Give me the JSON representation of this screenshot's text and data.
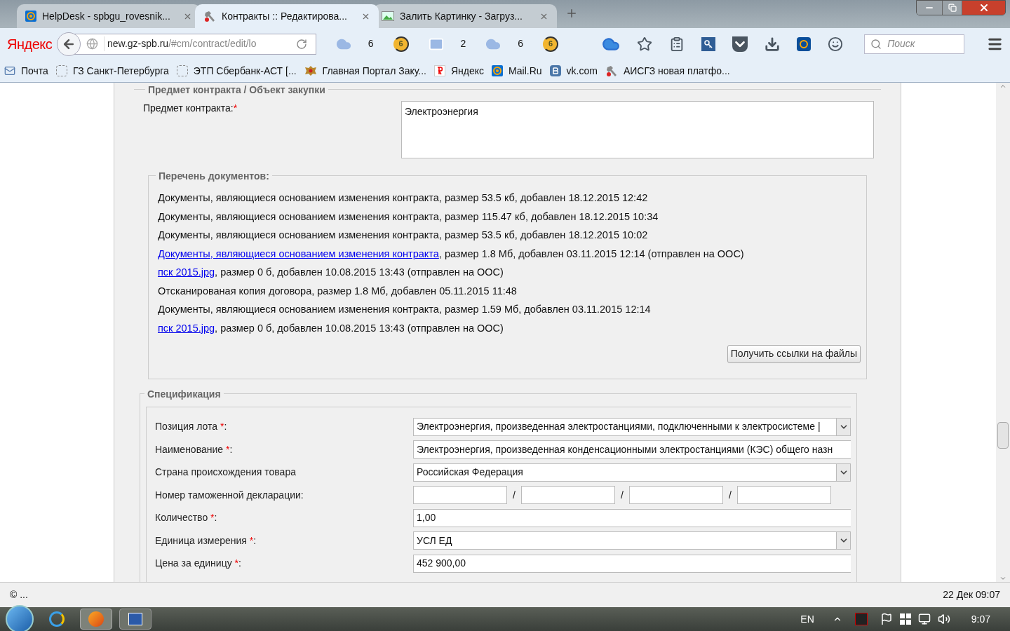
{
  "browser": {
    "tabs": [
      {
        "title": "HelpDesk - spbgu_rovesnik...",
        "kind": "mailru",
        "selected": false
      },
      {
        "title": "Контракты :: Редактирова...",
        "kind": "hammer",
        "selected": true
      },
      {
        "title": "Залить Картинку - Загруз...",
        "kind": "image",
        "selected": false
      }
    ],
    "logo": "Яндекс",
    "url_host": "new.gz-spb.ru",
    "url_path": "/#cm/contract/edit/lo",
    "widgets": [
      {
        "kind": "cloud",
        "value": "6"
      },
      {
        "kind": "coin",
        "value": "6"
      },
      {
        "kind": "mail",
        "value": "2"
      },
      {
        "kind": "cloud",
        "value": "6"
      },
      {
        "kind": "coin",
        "value": "6"
      }
    ],
    "search": {
      "placeholder": "Поиск"
    },
    "bookmarks": [
      {
        "label": "Почта",
        "kind": "mail"
      },
      {
        "label": "ГЗ Санкт-Петербурга",
        "kind": "blank"
      },
      {
        "label": "ЭТП Сбербанк-АСТ [...",
        "kind": "blank"
      },
      {
        "label": "Главная Портал Заку...",
        "kind": "emblem"
      },
      {
        "label": "Яндекс",
        "kind": "yandex"
      },
      {
        "label": "Mail.Ru",
        "kind": "mailru"
      },
      {
        "label": "vk.com",
        "kind": "vk"
      },
      {
        "label": "АИСГЗ новая платфо...",
        "kind": "hammer"
      }
    ]
  },
  "subject": {
    "legend": "Предмет контракта / Объект закупки",
    "label": "Предмет контракта:",
    "mark": "*",
    "value": "Электроэнергия"
  },
  "documents": {
    "legend": "Перечень документов:",
    "items": [
      {
        "text": "Документы, являющиеся основанием изменения контракта, размер 53.5 кб, добавлен 18.12.2015 12:42"
      },
      {
        "text": "Документы, являющиеся основанием изменения контракта, размер 115.47 кб, добавлен 18.12.2015 10:34"
      },
      {
        "text": "Документы, являющиеся основанием изменения контракта, размер 53.5 кб, добавлен 18.12.2015 10:02"
      },
      {
        "link": "Документы, являющиеся основанием изменения контракта",
        "text": ", размер 1.8 Мб, добавлен 03.11.2015 12:14 (отправлен на ООС)"
      },
      {
        "link": "пск 2015.jpg",
        "text": ", размер 0 б, добавлен 10.08.2015 13:43 (отправлен на ООС)"
      },
      {
        "text": "Отсканированая копия договора, размер 1.8 Мб, добавлен 05.11.2015 11:48"
      },
      {
        "text": "Документы, являющиеся основанием изменения контракта, размер 1.59 Мб, добавлен 03.11.2015 12:14"
      },
      {
        "link": "пск 2015.jpg",
        "text": ", размер 0 б, добавлен 10.08.2015 13:43 (отправлен на ООС)"
      }
    ],
    "button": "Получить ссылки на файлы"
  },
  "specification": {
    "legend": "Спецификация",
    "rows": [
      {
        "kind": "select",
        "label": "Позиция лота",
        "mark": "*",
        "colon": ":",
        "value": "Электроэнергия, произведенная электростанциями, подключенными к электросистеме |"
      },
      {
        "kind": "text",
        "label": "Наименование",
        "mark": "*",
        "colon": ":",
        "value": "Электроэнергия, произведенная конденсационными электростанциями (КЭС) общего назн"
      },
      {
        "kind": "select",
        "label": "Страна происхождения товара",
        "value": "Российская Федерация"
      },
      {
        "kind": "customs",
        "label": "Номер таможенной декларации:",
        "separators": [
          "/",
          "/",
          "/"
        ]
      },
      {
        "kind": "text",
        "label": "Количество",
        "mark": "*",
        "colon": ":",
        "value": "1,00"
      },
      {
        "kind": "select",
        "label": "Единица измерения",
        "mark": "*",
        "colon": ":",
        "value": "УСЛ ЕД"
      },
      {
        "kind": "text",
        "label": "Цена за единицу",
        "mark": "*",
        "colon": ":",
        "value": "452 900,00"
      }
    ]
  },
  "status_bar": {
    "left": "© ...",
    "right": "22 Дек 09:07"
  },
  "taskbar": {
    "language": "EN",
    "clock": "9:07"
  }
}
